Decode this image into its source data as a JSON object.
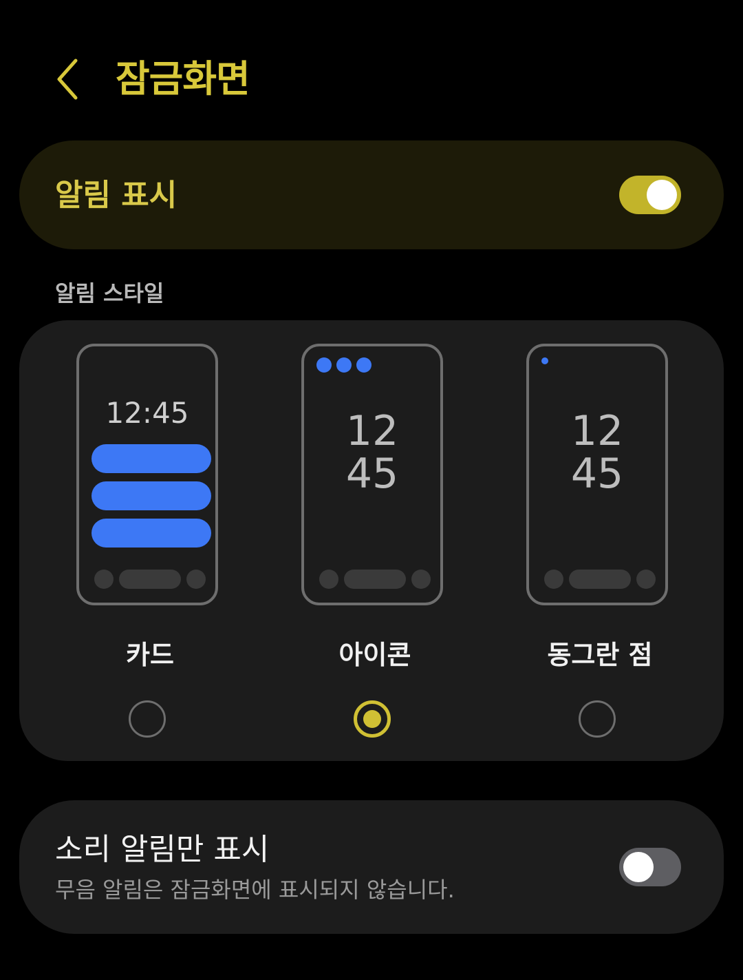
{
  "header": {
    "back_icon": "chevron-left-icon",
    "title": "잠금화면"
  },
  "master_switch": {
    "label": "알림 표시",
    "on": true
  },
  "style_section": {
    "label": "알림 스타일",
    "options": [
      {
        "name": "카드",
        "preview_clock": "12:45",
        "selected": false
      },
      {
        "name": "아이콘",
        "preview_clock_hour": "12",
        "preview_clock_min": "45",
        "selected": true
      },
      {
        "name": "동그란 점",
        "preview_clock_hour": "12",
        "preview_clock_min": "45",
        "selected": false
      }
    ]
  },
  "sound_only": {
    "title": "소리 알림만 표시",
    "subtitle": "무음 알림은 잠금화면에 표시되지 않습니다.",
    "on": false
  },
  "colors": {
    "accent": "#d0c034",
    "notification_blue": "#3d78f5",
    "card_bg": "#1c1c1c",
    "master_card_bg": "#1d1b08"
  }
}
